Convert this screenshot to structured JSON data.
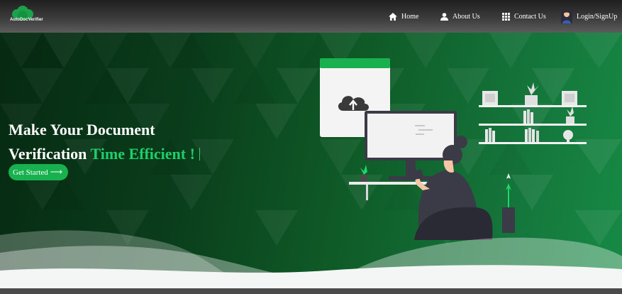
{
  "brand": {
    "logo_text": "AutoDocVerifier"
  },
  "nav": {
    "home": "Home",
    "about": "About Us",
    "contact": "Contact Us",
    "login": "Login/SignUp"
  },
  "hero": {
    "line1": "Make Your Document",
    "line2_plain": "Verification",
    "line2_accent": "Time Efficient !",
    "cta_label": "Get Started",
    "cta_arrow": "⟶"
  },
  "icons": {
    "home": "home-icon",
    "about": "user-icon",
    "contact": "grid-icon",
    "login": "avatar",
    "upload": "cloud-upload-icon"
  },
  "colors": {
    "accent": "#1fd06a",
    "button": "#17b24f",
    "nav_bg": "#3b3b3b",
    "hero_dark": "#062a12",
    "hero_light": "#178a45"
  }
}
